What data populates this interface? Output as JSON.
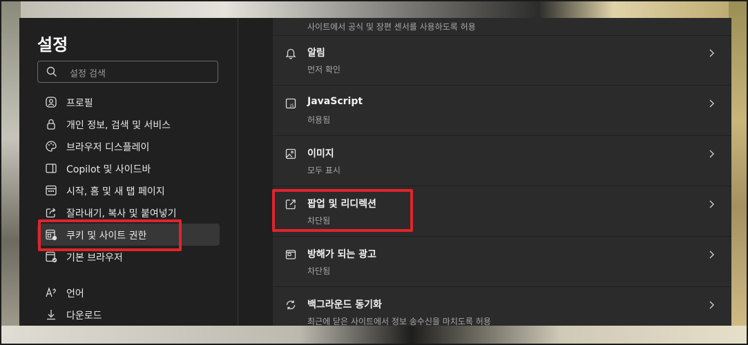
{
  "sidebar": {
    "title": "설정",
    "search_placeholder": "설정 검색",
    "items": [
      {
        "label": "프로필",
        "icon": "profile-icon"
      },
      {
        "label": "개인 정보, 검색 및 서비스",
        "icon": "lock-icon"
      },
      {
        "label": "브라우저 디스플레이",
        "icon": "palette-icon"
      },
      {
        "label": "Copilot 및 사이드바",
        "icon": "sidebar-icon"
      },
      {
        "label": "시작, 홈 및 새 탭 페이지",
        "icon": "home-tab-icon"
      },
      {
        "label": "잘라내기, 복사 및 붙여넣기",
        "icon": "share-icon"
      },
      {
        "label": "쿠키 및 사이트 권한",
        "icon": "cookie-site-icon"
      },
      {
        "label": "기본 브라우저",
        "icon": "default-browser-icon"
      },
      {
        "label": "언어",
        "icon": "language-icon"
      },
      {
        "label": "다운로드",
        "icon": "download-icon"
      }
    ]
  },
  "content": {
    "top_partial": "사이트에서 공식 및 장편 센서를 사용하도록 허용",
    "rows": [
      {
        "title": "알림",
        "subtitle": "먼저 확인",
        "icon": "bell-icon"
      },
      {
        "title": "JavaScript",
        "subtitle": "허용됨",
        "icon": "javascript-icon"
      },
      {
        "title": "이미지",
        "subtitle": "모두 표시",
        "icon": "image-icon"
      },
      {
        "title": "팝업 및 리디렉션",
        "subtitle": "차단됨",
        "icon": "popup-icon"
      },
      {
        "title": "방해가 되는 광고",
        "subtitle": "차단됨",
        "icon": "ads-icon"
      },
      {
        "title": "백그라운드 동기화",
        "subtitle": "최근에 닫은 사이트에서 정보 송수신을 마치도록 허용",
        "icon": "sync-icon"
      }
    ]
  },
  "colors": {
    "background": "#202020",
    "card": "#2b2b2b",
    "active_item": "#373737",
    "highlight": "#e0242c"
  }
}
